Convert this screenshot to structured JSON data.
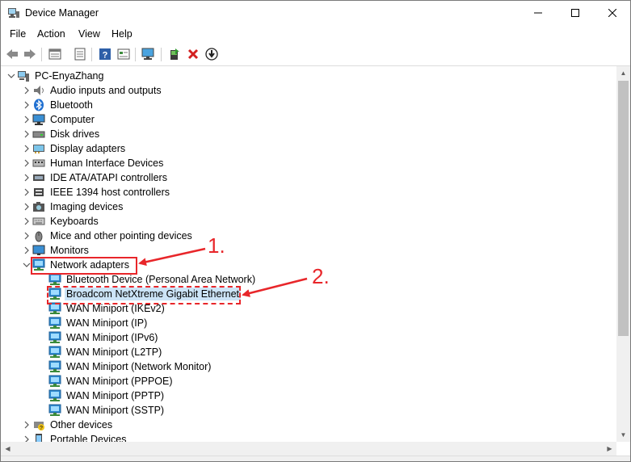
{
  "window": {
    "title": "Device Manager"
  },
  "menu": [
    "File",
    "Action",
    "View",
    "Help"
  ],
  "toolbar": {
    "buttons": [
      "back-icon",
      "forward-icon",
      "properties-icon",
      "help-icon",
      "show-hide-icon",
      "monitor-icon",
      "update-driver-icon",
      "uninstall-icon",
      "download-icon"
    ]
  },
  "tree": {
    "root": "PC-EnyaZhang",
    "categories": [
      {
        "label": "Audio inputs and outputs",
        "icon": "speaker-icon"
      },
      {
        "label": "Bluetooth",
        "icon": "bluetooth-icon"
      },
      {
        "label": "Computer",
        "icon": "computer-icon"
      },
      {
        "label": "Disk drives",
        "icon": "disk-drive-icon"
      },
      {
        "label": "Display adapters",
        "icon": "display-adapter-icon"
      },
      {
        "label": "Human Interface Devices",
        "icon": "hid-icon"
      },
      {
        "label": "IDE ATA/ATAPI controllers",
        "icon": "ide-controller-icon"
      },
      {
        "label": "IEEE 1394 host controllers",
        "icon": "ieee1394-icon"
      },
      {
        "label": "Imaging devices",
        "icon": "camera-icon"
      },
      {
        "label": "Keyboards",
        "icon": "keyboard-icon"
      },
      {
        "label": "Mice and other pointing devices",
        "icon": "mouse-icon"
      },
      {
        "label": "Monitors",
        "icon": "monitor-icon"
      },
      {
        "label": "Network adapters",
        "icon": "network-adapter-icon",
        "expanded": true
      }
    ],
    "network_children": [
      "Bluetooth Device (Personal Area Network)",
      "Broadcom NetXtreme Gigabit Ethernet",
      "WAN Miniport (IKEv2)",
      "WAN Miniport (IP)",
      "WAN Miniport (IPv6)",
      "WAN Miniport (L2TP)",
      "WAN Miniport (Network Monitor)",
      "WAN Miniport (PPPOE)",
      "WAN Miniport (PPTP)",
      "WAN Miniport (SSTP)"
    ],
    "after": [
      {
        "label": "Other devices",
        "icon": "unknown-device-icon"
      },
      {
        "label": "Portable Devices",
        "icon": "portable-device-icon"
      }
    ]
  },
  "annotations": {
    "step1": "1.",
    "step2": "2."
  },
  "colors": {
    "annotation": "#e8262a",
    "selection": "#cce4f7"
  }
}
